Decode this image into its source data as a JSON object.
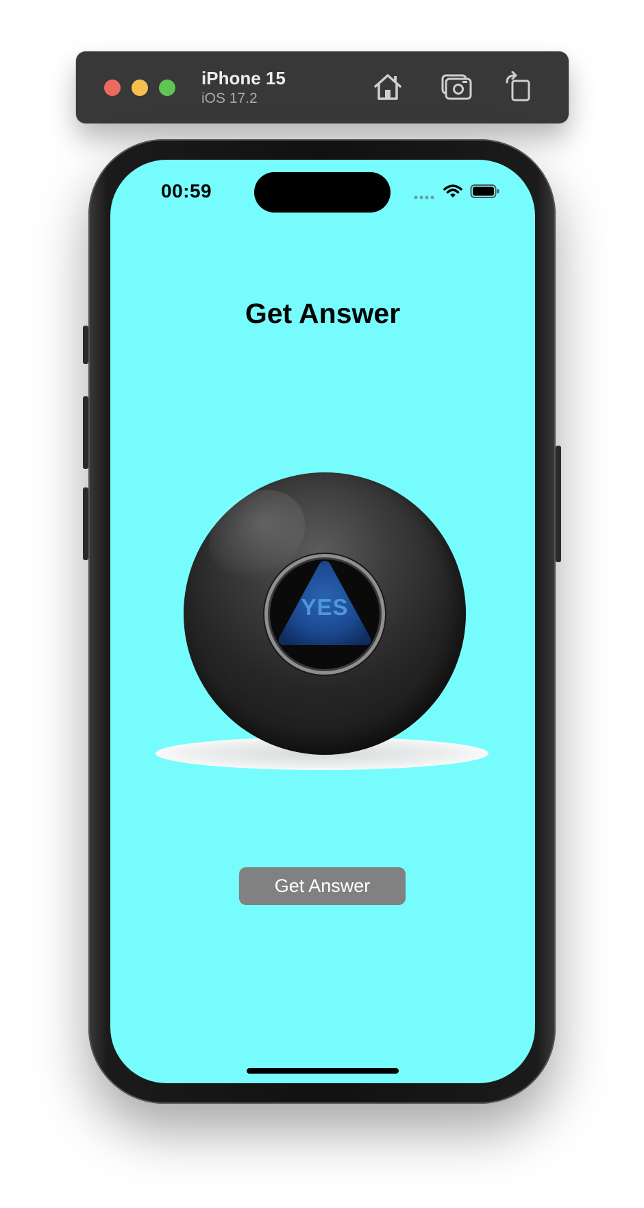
{
  "simulator": {
    "device_name": "iPhone 15",
    "os_version": "iOS 17.2",
    "icons": [
      "home-icon",
      "screenshot-icon",
      "rotate-icon"
    ]
  },
  "status_bar": {
    "time": "00:59",
    "icons": [
      "cellular-icon",
      "wifi-icon",
      "battery-icon"
    ]
  },
  "app": {
    "title": "Get Answer",
    "answer": "YES",
    "button_label": "Get Answer",
    "background_color": "#77fcfd",
    "button_color": "#818181",
    "answer_color": "#4e98d8"
  }
}
